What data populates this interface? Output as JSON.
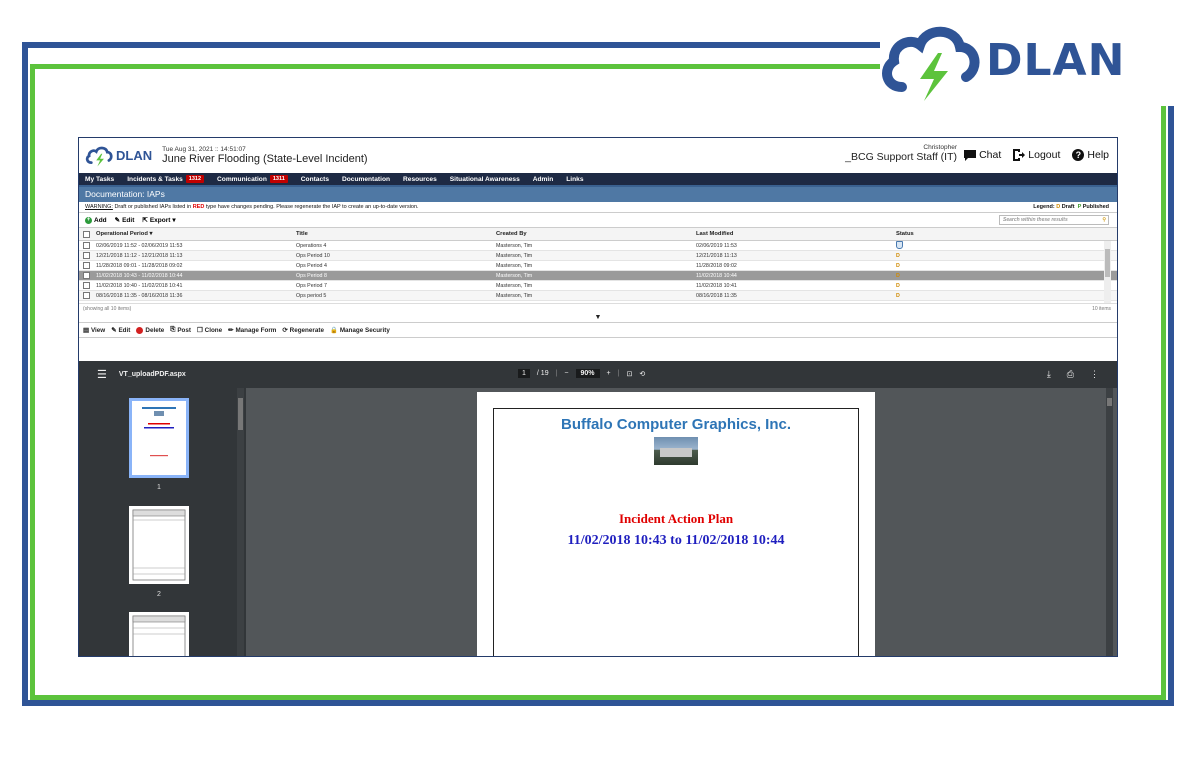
{
  "brand": {
    "name": "DLAN"
  },
  "app": {
    "logo_text": "DLAN",
    "datetime": "Tue Aug 31, 2021 :: 14:51:07",
    "incident": "June River Flooding (State-Level Incident)",
    "user_name": "Christopher",
    "user_role": "_BCG Support Staff (IT)",
    "chat": "Chat",
    "logout": "Logout",
    "help": "Help"
  },
  "nav": [
    {
      "label": "My Tasks"
    },
    {
      "label": "Incidents & Tasks",
      "badge": "1312"
    },
    {
      "label": "Communication",
      "badge": "1311"
    },
    {
      "label": "Contacts"
    },
    {
      "label": "Documentation"
    },
    {
      "label": "Resources"
    },
    {
      "label": "Situational Awareness"
    },
    {
      "label": "Admin"
    },
    {
      "label": "Links"
    }
  ],
  "section_title": "Documentation: IAPs",
  "warning": {
    "label": "WARNING:",
    "text_a": "Draft or published IAPs listed in",
    "red_word": "RED",
    "text_b": "type have changes pending. Please regenerate the IAP to create an up-to-date version.",
    "legend_label": "Legend:",
    "legend_d": "D",
    "legend_draft": "Draft",
    "legend_p": "P",
    "legend_published": "Published"
  },
  "toolbar": {
    "add": "Add",
    "edit": "Edit",
    "export": "Export",
    "search_placeholder": "Search within these results"
  },
  "grid": {
    "headers": [
      "Operational Period",
      "Title",
      "Created By",
      "Last Modified",
      "Status"
    ],
    "rows": [
      {
        "period": "02/06/2019 11:52 - 02/06/2019 11:53",
        "title": "Operations 4",
        "by": "Masterson, Tim",
        "modified": "02/06/2019 11:53",
        "status": "shield"
      },
      {
        "period": "12/21/2018 11:12 - 12/21/2018 11:13",
        "title": "Ops Period 10",
        "by": "Masterson, Tim",
        "modified": "12/21/2018 11:13",
        "status": "D"
      },
      {
        "period": "11/28/2018 09:01 - 11/28/2018 09:02",
        "title": "Ops Period 4",
        "by": "Masterson, Tim",
        "modified": "11/28/2018 09:02",
        "status": "D"
      },
      {
        "period": "11/02/2018 10:43 - 11/02/2018 10:44",
        "title": "Ops Period 8",
        "by": "Masterson, Tim",
        "modified": "11/02/2018 10:44",
        "status": "D",
        "selected": true
      },
      {
        "period": "11/02/2018 10:40 - 11/02/2018 10:41",
        "title": "Ops Period 7",
        "by": "Masterson, Tim",
        "modified": "11/02/2018 10:41",
        "status": "D"
      },
      {
        "period": "08/16/2018 11:35 - 08/16/2018 11:36",
        "title": "Ops period 5",
        "by": "Masterson, Tim",
        "modified": "08/16/2018 11:35",
        "status": "D"
      }
    ],
    "footer_left": "(showing all 10 items)",
    "footer_right": "10 items"
  },
  "actions": [
    "View",
    "Edit",
    "Delete",
    "Post",
    "Clone",
    "Manage Form",
    "Regenerate",
    "Manage Security"
  ],
  "viewer": {
    "filename": "VT_uploadPDF.aspx",
    "page_current": "1",
    "page_total": "/ 19",
    "zoom": "90%",
    "thumb_labels": [
      "1",
      "2"
    ]
  },
  "pdf": {
    "company": "Buffalo Computer Graphics, Inc.",
    "doc_title": "Incident Action Plan",
    "range": "11/02/2018 10:43 to 11/02/2018 10:44"
  }
}
